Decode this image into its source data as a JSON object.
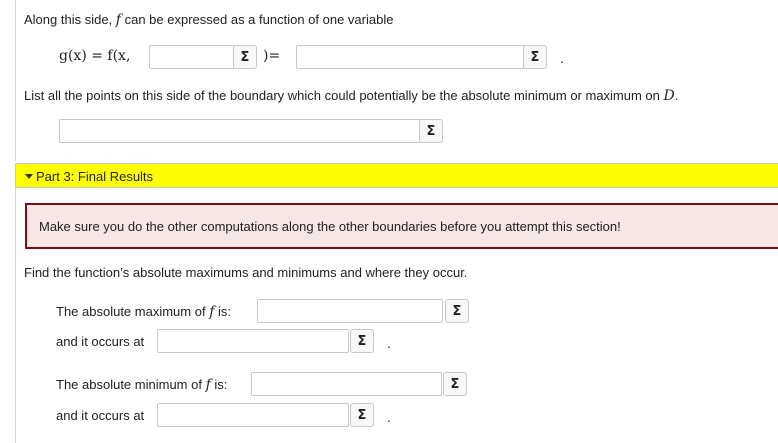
{
  "part2": {
    "intro_prefix": "Along this side,",
    "intro_var": "f",
    "intro_suffix": "can be expressed as a function of one variable",
    "equation_left": "g(x) = f(x,",
    "equation_mid": ")=",
    "equation_end": ".",
    "list_prompt": "List all the points on this side of the boundary which could potentially be the absolute minimum or maximum on",
    "list_domain": "D",
    "list_end": "."
  },
  "part3": {
    "header": "Part 3: Final Results",
    "warning": "Make sure you do the other computations along the other boundaries before you attempt this section!",
    "instruction": "Find the function’s absolute maximums and minimums and where they occur.",
    "max_prefix": "The absolute maximum of",
    "min_prefix": "The absolute minimum of",
    "f_var": "f",
    "is_label": "is:",
    "occurs_at": "and it occurs at",
    "period": "."
  },
  "sigma_symbol": "Σ",
  "colors": {
    "part_bar": "#ffff00",
    "warning_bg": "#f7e6e6",
    "warning_border": "#7b0f12"
  }
}
